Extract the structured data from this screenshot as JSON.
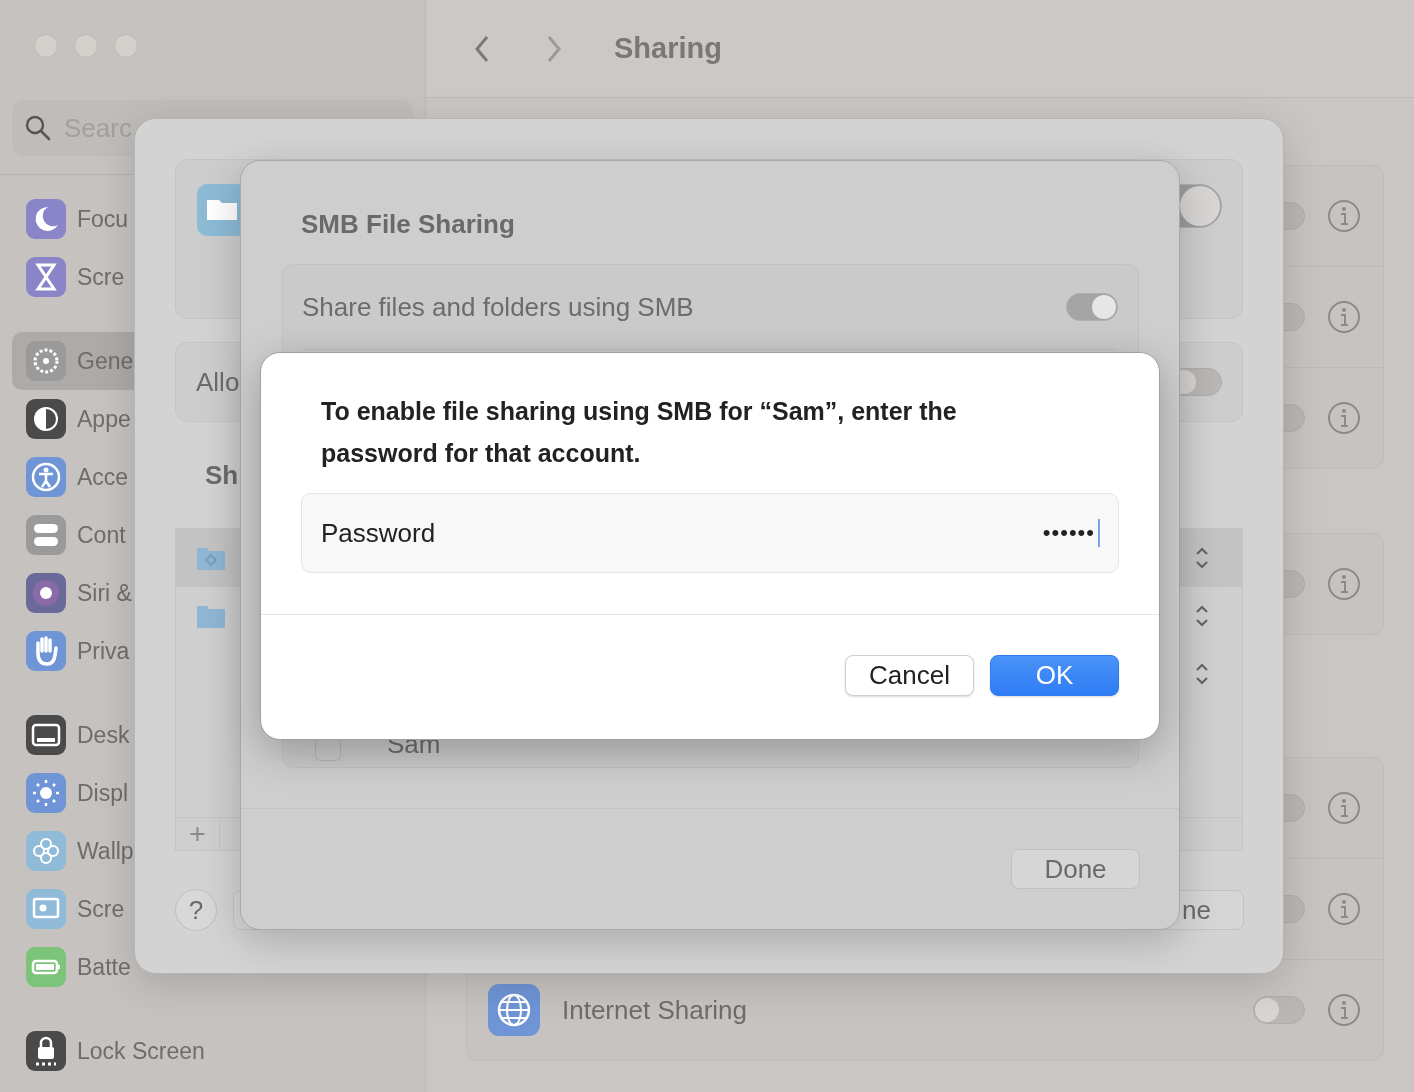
{
  "sidebar": {
    "search": {
      "placeholder": "Searc"
    },
    "groups": [
      {
        "items": [
          {
            "label": "Focu",
            "kind": "moon",
            "color": "#8a84c9",
            "selected": false
          },
          {
            "label": "Scre",
            "kind": "hourglass",
            "color": "#8a84c9",
            "selected": false
          }
        ]
      },
      {
        "items": [
          {
            "label": "Gene",
            "kind": "gear",
            "color": "#9a9a9a",
            "selected": true
          },
          {
            "label": "Appe",
            "kind": "appearance",
            "color": "#4a4a4a",
            "selected": false
          },
          {
            "label": "Acce",
            "kind": "accessibility",
            "color": "#6f95d6",
            "selected": false
          },
          {
            "label": "Cont",
            "kind": "switches",
            "color": "#9a9a9a",
            "selected": false
          },
          {
            "label": "Siri &",
            "kind": "siri",
            "color": "#6a6a9a",
            "selected": false
          },
          {
            "label": "Priva",
            "kind": "hand",
            "color": "#6f95d6",
            "selected": false
          }
        ]
      },
      {
        "items": [
          {
            "label": "Desk",
            "kind": "dock",
            "color": "#4a4a4a",
            "selected": false
          },
          {
            "label": "Displ",
            "kind": "sun",
            "color": "#6f95d6",
            "selected": false
          },
          {
            "label": "Wallp",
            "kind": "flower",
            "color": "#8fbbd8",
            "selected": false
          },
          {
            "label": "Scre",
            "kind": "screensaver",
            "color": "#8fbbd8",
            "selected": false
          },
          {
            "label": "Batte",
            "kind": "battery",
            "color": "#7cc47a",
            "selected": false
          }
        ]
      },
      {
        "items": [
          {
            "label": "Lock Screen",
            "kind": "lock",
            "color": "#4a4a4a",
            "selected": false
          }
        ]
      }
    ]
  },
  "toolbar": {
    "title": "Sharing"
  },
  "services": {
    "groups": [
      {
        "rows": [
          {
            "on": false
          },
          {
            "on": false
          },
          {
            "on": false
          }
        ]
      },
      {
        "rows": [
          {
            "on": false
          }
        ]
      },
      {
        "rows": [
          {
            "on": false
          },
          {
            "on": false
          },
          {
            "label": "Internet Sharing",
            "kind": "globe",
            "on": false
          }
        ]
      }
    ]
  },
  "file_sharing_sheet": {
    "service_on": true,
    "allow_label": "Allo",
    "allow_on": false,
    "section_label": "Sh",
    "folders": [
      {
        "kind": "badge",
        "selected": true
      },
      {
        "kind": "plain",
        "selected": false
      }
    ],
    "add": "+",
    "help": "?",
    "done": "ne"
  },
  "smb_sheet": {
    "title": "SMB File Sharing",
    "share_label": "Share files and folders using SMB",
    "share_on": true,
    "users": [
      {
        "name": "Sam",
        "checked": false
      }
    ],
    "done": "Done"
  },
  "password_alert": {
    "message": "To enable file sharing using SMB for “Sam”, enter the password for that account.",
    "field_label": "Password",
    "value": "••••••",
    "buttons": [
      {
        "label": "Cancel",
        "kind": "secondary"
      },
      {
        "label": "OK",
        "kind": "default"
      }
    ]
  }
}
